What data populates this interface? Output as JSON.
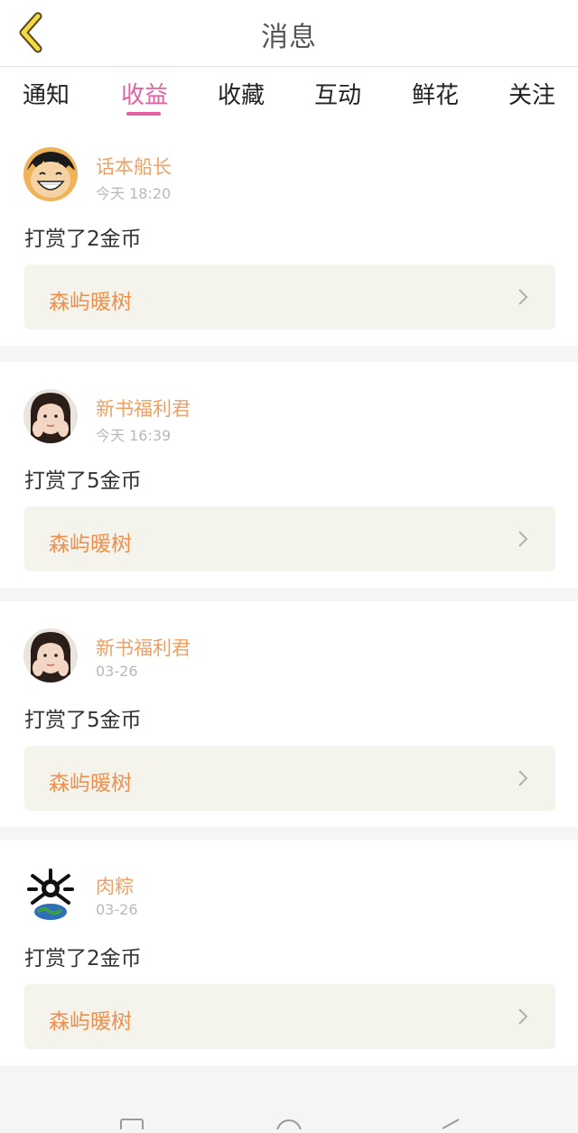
{
  "header": {
    "title": "消息"
  },
  "tabs": [
    {
      "label": "通知"
    },
    {
      "label": "收益"
    },
    {
      "label": "收藏"
    },
    {
      "label": "互动"
    },
    {
      "label": "鲜花"
    },
    {
      "label": "关注"
    }
  ],
  "active_tab": "收益",
  "items": [
    {
      "user": "话本船长",
      "time": "今天 18:20",
      "message": "打赏了2金币",
      "book": "森屿暖树",
      "avatar_icon": "cartoon-boy-avatar"
    },
    {
      "user": "新书福利君",
      "time": "今天 16:39",
      "message": "打赏了5金币",
      "book": "森屿暖树",
      "avatar_icon": "girl-photo-avatar"
    },
    {
      "user": "新书福利君",
      "time": "03-26",
      "message": "打赏了5金币",
      "book": "森屿暖树",
      "avatar_icon": "girl-photo-avatar"
    },
    {
      "user": "肉粽",
      "time": "03-26",
      "message": "打赏了2金币",
      "book": "森屿暖树",
      "avatar_icon": "skull-earth-avatar"
    }
  ],
  "colors": {
    "accent": "#e55fa3",
    "username": "#f0a063",
    "book_title": "#f08f4c",
    "book_bar_bg": "#f4f4ec"
  }
}
